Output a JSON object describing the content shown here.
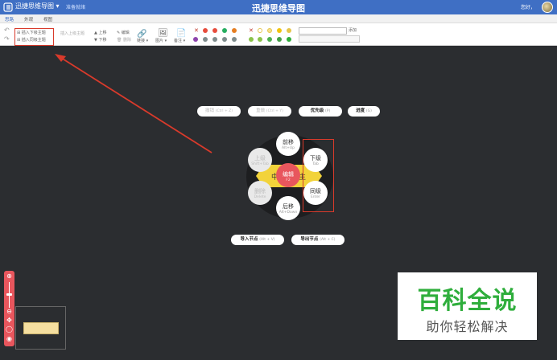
{
  "titlebar": {
    "app_menu": "迅捷思维导图 ▾",
    "status": "准备就绪",
    "title": "迅捷思维导图",
    "user": "您好，"
  },
  "tabs": [
    {
      "label": "思路",
      "active": true
    },
    {
      "label": "外观",
      "active": false
    },
    {
      "label": "视图",
      "active": false
    }
  ],
  "toolbar": {
    "insert_child": "插入下级主题",
    "insert_sibling": "插入同级主题",
    "insert_parent": "插入上级主题",
    "move_up": "上移",
    "move_down": "下移",
    "edit": "编辑",
    "delete": "删除",
    "link": "链接 ▾",
    "image": "图片 ▾",
    "note": "备注 ▾",
    "add": "添加",
    "priority_labels": [
      "1",
      "2",
      "3",
      "4",
      "5",
      "6",
      "7",
      "8",
      "9"
    ]
  },
  "colors": {
    "brand": "#3f6fc4",
    "accent_red": "#e8565d",
    "center_topic": "#f2d33a",
    "annotation": "#d93a2b",
    "watermark_green": "#2fae3c",
    "priority": [
      "#e74c3c",
      "#e74c3c",
      "#27ae60",
      "#2980b9",
      "#e67e22",
      "#8e44ad",
      "#7f8c8d",
      "#7f8c8d",
      "#7f8c8d"
    ]
  },
  "pills": {
    "undo": {
      "label": "撤销",
      "shortcut": "(Ctrl + Z)"
    },
    "redo": {
      "label": "重做",
      "shortcut": "(Ctrl + Y)"
    },
    "priority": {
      "label": "优先级",
      "shortcut": "(P)"
    },
    "progress": {
      "label": "进度",
      "shortcut": "(G)"
    },
    "import": {
      "label": "导入节点",
      "shortcut": "(Alt + V)"
    },
    "export": {
      "label": "导出节点",
      "shortcut": "(Alt + C)"
    }
  },
  "radial": {
    "center_text_left": "中",
    "center_text_right": "主",
    "edit": {
      "label": "编辑",
      "shortcut": "F2"
    },
    "move_forward": {
      "label": "前移",
      "shortcut": "Alt+Up"
    },
    "move_back": {
      "label": "后移",
      "shortcut": "Alt+Down"
    },
    "parent": {
      "label": "上级",
      "shortcut": "Shift+Tab"
    },
    "child": {
      "label": "下级",
      "shortcut": "Tab"
    },
    "delete": {
      "label": "删除",
      "shortcut": "Delete"
    },
    "sibling": {
      "label": "同级",
      "shortcut": "Enter"
    }
  },
  "watermark": {
    "big": "百科全说",
    "small": "助你轻松解决"
  },
  "zoom": {
    "plus": "⊕",
    "minus": "⊖",
    "move": "✥",
    "fit": "◯",
    "eye": "◉"
  }
}
